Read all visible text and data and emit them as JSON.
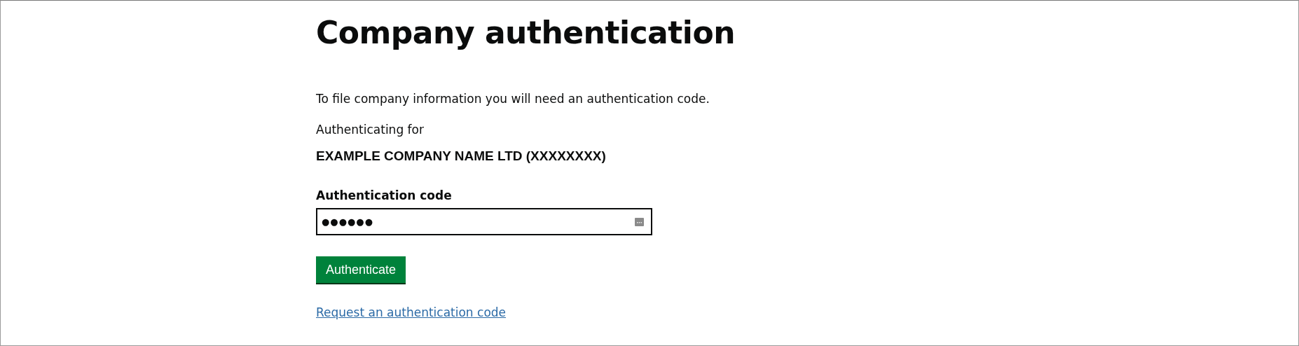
{
  "heading": "Company authentication",
  "intro": "To file company information you will need an authentication code.",
  "authenticating_label": "Authenticating for",
  "company": "EXAMPLE COMPANY NAME LTD (XXXXXXXX)",
  "code_field": {
    "label": "Authentication code",
    "value": "●●●●●●"
  },
  "button": "Authenticate",
  "link": "Request an authentication code"
}
